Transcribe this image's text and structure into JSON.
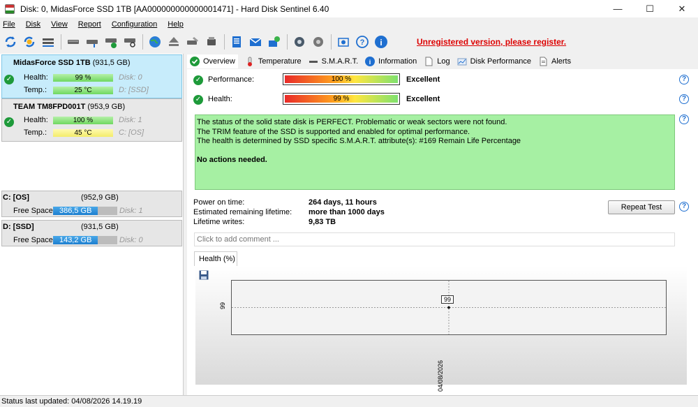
{
  "window": {
    "title": "Disk: 0, MidasForce SSD 1TB [AA000000000000001471]  -  Hard Disk Sentinel 6.40",
    "minimize": "—",
    "maximize": "☐",
    "close": "✕"
  },
  "menu": [
    "File",
    "Disk",
    "View",
    "Report",
    "Configuration",
    "Help"
  ],
  "toolbar": {
    "registration_warning": "Unregistered version, please register."
  },
  "disks": [
    {
      "name": "MidasForce SSD 1TB",
      "size": "(931,5 GB)",
      "health_label": "Health:",
      "health_value": "99 %",
      "health_fraction": 0.99,
      "health_extra": "Disk: 0",
      "temp_label": "Temp.:",
      "temp_value": "25 °C",
      "temp_extra": "D: [SSD]",
      "selected": true
    },
    {
      "name": "TEAM TM8FPD001T",
      "size": "(953,9 GB)",
      "health_label": "Health:",
      "health_value": "100 %",
      "health_fraction": 1.0,
      "health_extra": "Disk: 1",
      "temp_label": "Temp.:",
      "temp_value": "45 °C",
      "temp_extra": "C: [OS]",
      "selected": false
    }
  ],
  "volumes": [
    {
      "name": "C: [OS]",
      "size": "(952,9 GB)",
      "free_label": "Free Space",
      "free_value": "386,5 GB",
      "free_fraction": 0.41,
      "disk": "Disk: 1"
    },
    {
      "name": "D: [SSD]",
      "size": "(931,5 GB)",
      "free_label": "Free Space",
      "free_value": "143,2 GB",
      "free_fraction": 0.15,
      "disk": "Disk: 0"
    }
  ],
  "tabs": [
    "Overview",
    "Temperature",
    "S.M.A.R.T.",
    "Information",
    "Log",
    "Disk Performance",
    "Alerts"
  ],
  "overview": {
    "performance_label": "Performance:",
    "performance_value": "100 %",
    "performance_text": "Excellent",
    "health_label": "Health:",
    "health_value": "99 %",
    "health_text": "Excellent",
    "status_lines": [
      "The status of the solid state disk is PERFECT. Problematic or weak sectors were not found.",
      "The TRIM feature of the SSD is supported and enabled for optimal performance.",
      "The health is determined by SSD specific S.M.A.R.T. attribute(s):  #169 Remain Life Percentage"
    ],
    "status_action": "No actions needed.",
    "status_color": "#a6f0a3",
    "power_on_label": "Power on time:",
    "power_on_value": "264 days, 11 hours",
    "remaining_label": "Estimated remaining lifetime:",
    "remaining_value": "more than 1000 days",
    "writes_label": "Lifetime writes:",
    "writes_value": "9,83 TB",
    "repeat_button": "Repeat Test",
    "comment_placeholder": "Click to add comment ..."
  },
  "graph": {
    "tab_label": "Health (%)",
    "y_tick": "99",
    "x_tick": "04/08/2026",
    "point_label": "99"
  },
  "chart_data": {
    "type": "line",
    "x": [
      "04/08/2026"
    ],
    "series": [
      {
        "values": [
          99
        ]
      }
    ]
  },
  "statusbar": {
    "text": "Status last updated: 04/08/2026 14.19.19"
  }
}
